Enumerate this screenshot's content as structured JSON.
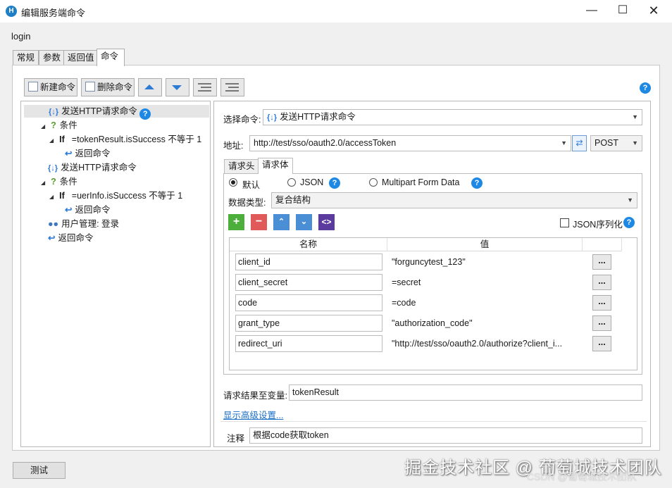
{
  "window": {
    "title": "编辑服务端命令",
    "logo": "H"
  },
  "command_name": "login",
  "tabs": [
    {
      "label": "常规"
    },
    {
      "label": "参数"
    },
    {
      "label": "返回值"
    },
    {
      "label": "命令"
    }
  ],
  "toolbar": {
    "new_label": "新建命令",
    "delete_label": "删除命令"
  },
  "tree": [
    {
      "text": "发送HTTP请求命令"
    },
    {
      "text": "条件"
    },
    {
      "if_kw": "If",
      "text": "=tokenResult.isSuccess 不等于 1"
    },
    {
      "text": "返回命令"
    },
    {
      "text": "发送HTTP请求命令"
    },
    {
      "text": "条件"
    },
    {
      "if_kw": "If",
      "text": "=uerInfo.isSuccess 不等于 1"
    },
    {
      "text": "返回命令"
    },
    {
      "text": "用户管理: 登录"
    },
    {
      "text": "返回命令"
    }
  ],
  "form": {
    "select_label": "选择命令:",
    "select_value": "发送HTTP请求命令",
    "address_label": "地址:",
    "address_value": "http://test/sso/oauth2.0/accessToken",
    "method": "POST",
    "subtabs": [
      {
        "label": "请求头"
      },
      {
        "label": "请求体"
      }
    ],
    "body_types": [
      {
        "label": "默认"
      },
      {
        "label": "JSON"
      },
      {
        "label": "Multipart Form Data"
      }
    ],
    "data_type_label": "数据类型:",
    "data_type_value": "复合结构",
    "json_serialize_label": "JSON序列化",
    "grid_headers": {
      "name": "名称",
      "value": "值"
    },
    "rows": [
      {
        "name": "client_id",
        "value": "\"forguncytest_123\""
      },
      {
        "name": "client_secret",
        "value": "=secret"
      },
      {
        "name": "code",
        "value": "=code"
      },
      {
        "name": "grant_type",
        "value": "\"authorization_code\""
      },
      {
        "name": "redirect_uri",
        "value": "\"http://test/sso/oauth2.0/authorize?client_i..."
      }
    ],
    "ellipsis": "...",
    "result_var_label": "请求结果至变量:",
    "result_var_value": "tokenResult",
    "advanced_link": "显示高级设置...",
    "comment_label": "注释",
    "comment_value": "根据code获取token"
  },
  "test_button": "测试",
  "watermark": "掘金技术社区 @ 葡萄城技术团队",
  "watermark_small": "CSDN @葡萄城技术团队"
}
